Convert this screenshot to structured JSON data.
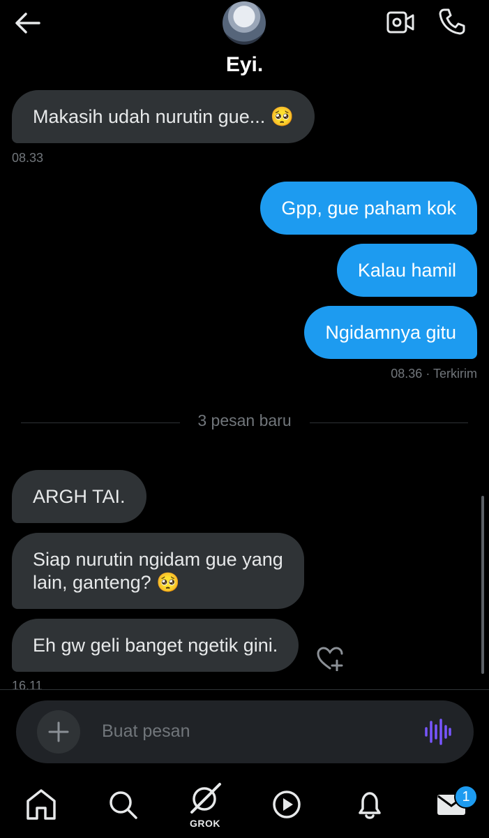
{
  "header": {
    "title": "Eyi.",
    "icons": {
      "back": "arrow-left-icon",
      "video": "video-camera-icon",
      "call": "phone-icon"
    }
  },
  "messages": [
    {
      "side": "in",
      "text": "Makasih udah nurutin gue... 🥺"
    },
    {
      "side": "out",
      "text": "Gpp, gue paham kok"
    },
    {
      "side": "out",
      "text": "Kalau hamil"
    },
    {
      "side": "out",
      "text": "Ngidamnya gitu"
    },
    {
      "side": "in",
      "text": "ARGH TAI."
    },
    {
      "side": "in",
      "line1": "Siap nurutin ngidam gue yang",
      "line2": "lain, ganteng? 🥺"
    },
    {
      "side": "in",
      "text": "Eh gw geli banget ngetik gini."
    }
  ],
  "timestamps": {
    "first": "08.33",
    "sent": "08.36",
    "sent_status": "· Terkirim",
    "last": "16.11"
  },
  "divider": {
    "text": "3 pesan baru"
  },
  "composer": {
    "placeholder": "Buat pesan"
  },
  "tabbar": {
    "items": [
      "home-icon",
      "search-icon",
      "grok-icon",
      "play-icon",
      "bell-icon",
      "mail-icon"
    ],
    "grok_label": "GROK",
    "mail_badge": "1"
  },
  "colors": {
    "background": "#000000",
    "incoming": "#2f3336",
    "outgoing": "#1d9bf0",
    "voice_accent": "#7856ff"
  }
}
